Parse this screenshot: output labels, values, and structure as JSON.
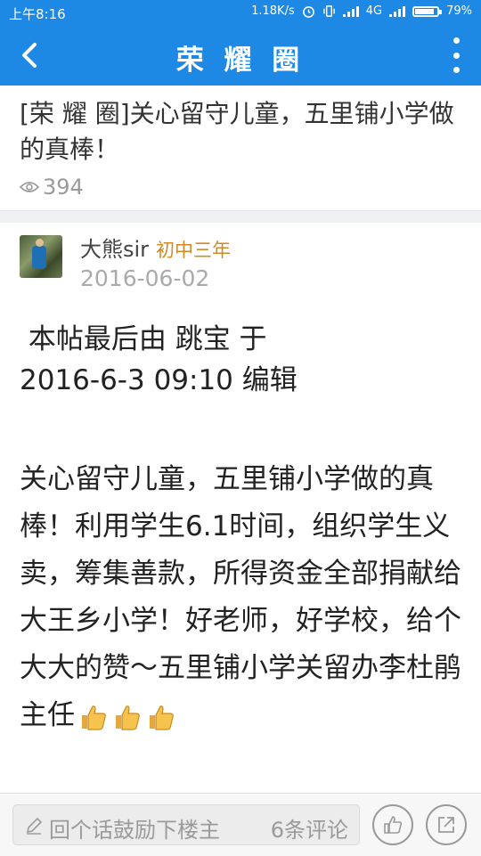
{
  "status_bar": {
    "time": "上午8:16",
    "net_speed": "1.18K/s",
    "network": "4G",
    "battery": "79%",
    "battery_level": 0.79
  },
  "app_bar": {
    "title": "荣 耀 圈",
    "back_icon": "chevron-left-icon",
    "menu_icon": "more-vertical-icon"
  },
  "thread": {
    "title": "[荣 耀 圈]关心留守儿童，五里铺小学做的真棒！",
    "views": "394"
  },
  "post": {
    "author": "大熊sir",
    "grade": "初中三年",
    "date": "2016-06-02",
    "edit_note_line1": " 本帖最后由 跳宝 于",
    "edit_note_line2": "2016-6-3 09:10 编辑",
    "body": "关心留守儿童，五里铺小学做的真棒！利用学生6.1时间，组织学生义卖，筹集善款，所得资金全部捐献给大王乡小学！好老师，好学校，给个大大的赞～五里铺小学关留办李杜鹃主任"
  },
  "bottom_bar": {
    "comment_placeholder": "回个话鼓励下楼主",
    "comment_count": "6条评论"
  },
  "colors": {
    "primary": "#1e88e5",
    "grade": "#d08a27",
    "muted": "#9a9a9a"
  }
}
